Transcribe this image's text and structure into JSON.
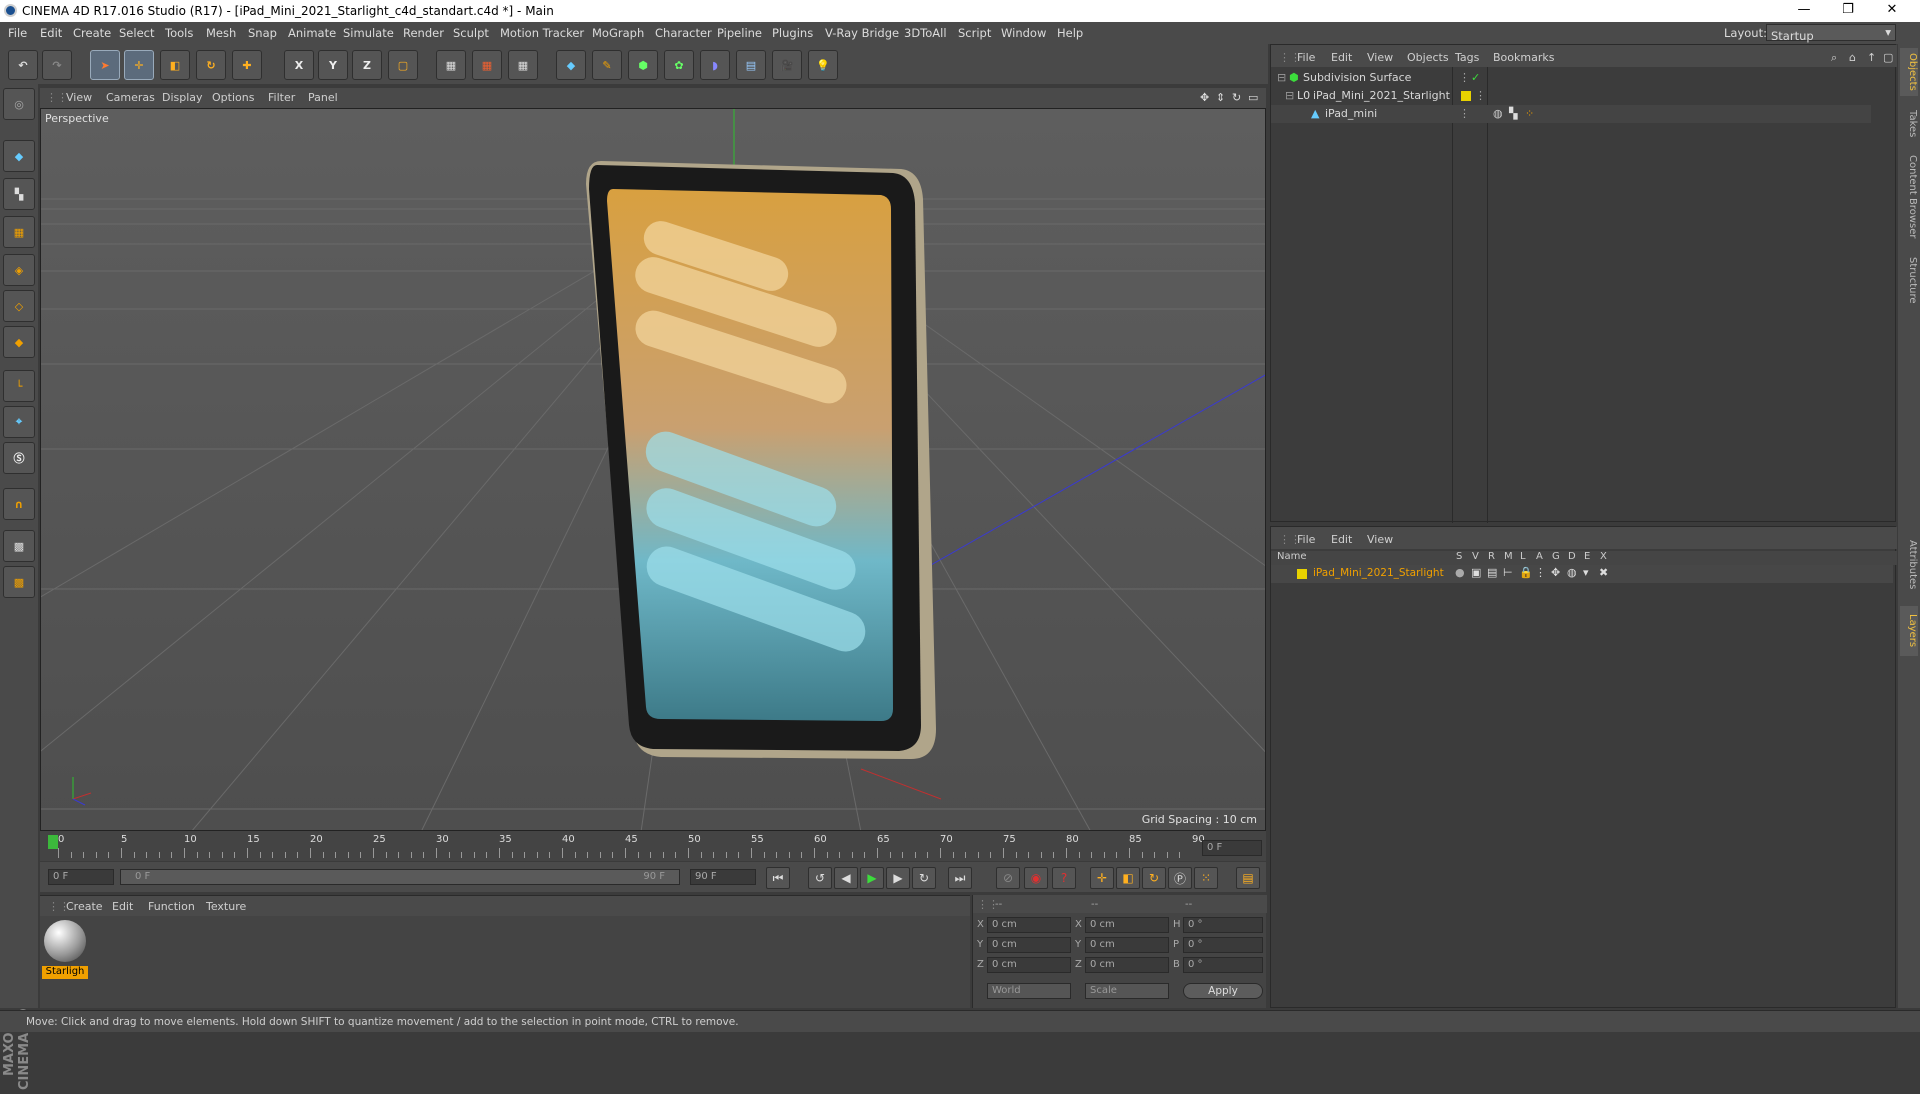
{
  "window": {
    "title": "CINEMA 4D R17.016 Studio (R17) - [iPad_Mini_2021_Starlight_c4d_standart.c4d *] - Main",
    "min": "—",
    "max": "❐",
    "close": "✕"
  },
  "menu": [
    "File",
    "Edit",
    "Create",
    "Select",
    "Tools",
    "Mesh",
    "Snap",
    "Animate",
    "Simulate",
    "Render",
    "Sculpt",
    "Motion Tracker",
    "MoGraph",
    "Character",
    "Pipeline",
    "Plugins",
    "V-Ray Bridge",
    "3DToAll",
    "Script",
    "Window",
    "Help"
  ],
  "layout": {
    "label": "Layout:",
    "value": "Startup"
  },
  "toolbar": {
    "x": "X",
    "y": "Y",
    "z": "Z"
  },
  "viewport": {
    "menu": [
      "View",
      "Cameras",
      "Display",
      "Options",
      "Filter",
      "Panel"
    ],
    "label": "Perspective",
    "grid_spacing": "Grid Spacing : 10 cm"
  },
  "timeline": {
    "ticks": [
      "0",
      "5",
      "10",
      "15",
      "20",
      "25",
      "30",
      "35",
      "40",
      "45",
      "50",
      "55",
      "60",
      "65",
      "70",
      "75",
      "80",
      "85",
      "90"
    ],
    "current": "0 F",
    "start": "0 F",
    "range_start": "0 F",
    "range_end": "90 F",
    "end": "90 F"
  },
  "material_manager": {
    "menu": [
      "Create",
      "Edit",
      "Function",
      "Texture"
    ],
    "material_name": "Starligh"
  },
  "attributes": {
    "headers": [
      "--",
      "--",
      "--"
    ],
    "rows": [
      {
        "a": "X",
        "av": "0 cm",
        "b": "X",
        "bv": "0 cm",
        "c": "H",
        "cv": "0 °"
      },
      {
        "a": "Y",
        "av": "0 cm",
        "b": "Y",
        "bv": "0 cm",
        "c": "P",
        "cv": "0 °"
      },
      {
        "a": "Z",
        "av": "0 cm",
        "b": "Z",
        "bv": "0 cm",
        "c": "B",
        "cv": "0 °"
      }
    ],
    "coord_system": "World",
    "mode": "Scale",
    "apply": "Apply"
  },
  "status": "Move: Click and drag to move elements. Hold down SHIFT to quantize movement / add to the selection in point mode, CTRL to remove.",
  "object_manager": {
    "menu": [
      "File",
      "Edit",
      "View",
      "Objects",
      "Tags",
      "Bookmarks"
    ],
    "objects": [
      {
        "name": "Subdivision Surface",
        "indent": 0
      },
      {
        "name": "iPad_Mini_2021_Starlight",
        "indent": 1
      },
      {
        "name": "iPad_mini",
        "indent": 2
      }
    ]
  },
  "layer_manager": {
    "menu": [
      "File",
      "Edit",
      "View"
    ],
    "columns": [
      "Name",
      "S",
      "V",
      "R",
      "M",
      "L",
      "A",
      "G",
      "D",
      "E",
      "X"
    ],
    "layer": "iPad_Mini_2021_Starlight"
  },
  "right_tabs": [
    "Objects",
    "Takes",
    "Content Browser",
    "Structure",
    "Attributes",
    "Layers"
  ],
  "colors": {
    "accent": "#f0a000",
    "layer_yellow": "#e8d200"
  }
}
